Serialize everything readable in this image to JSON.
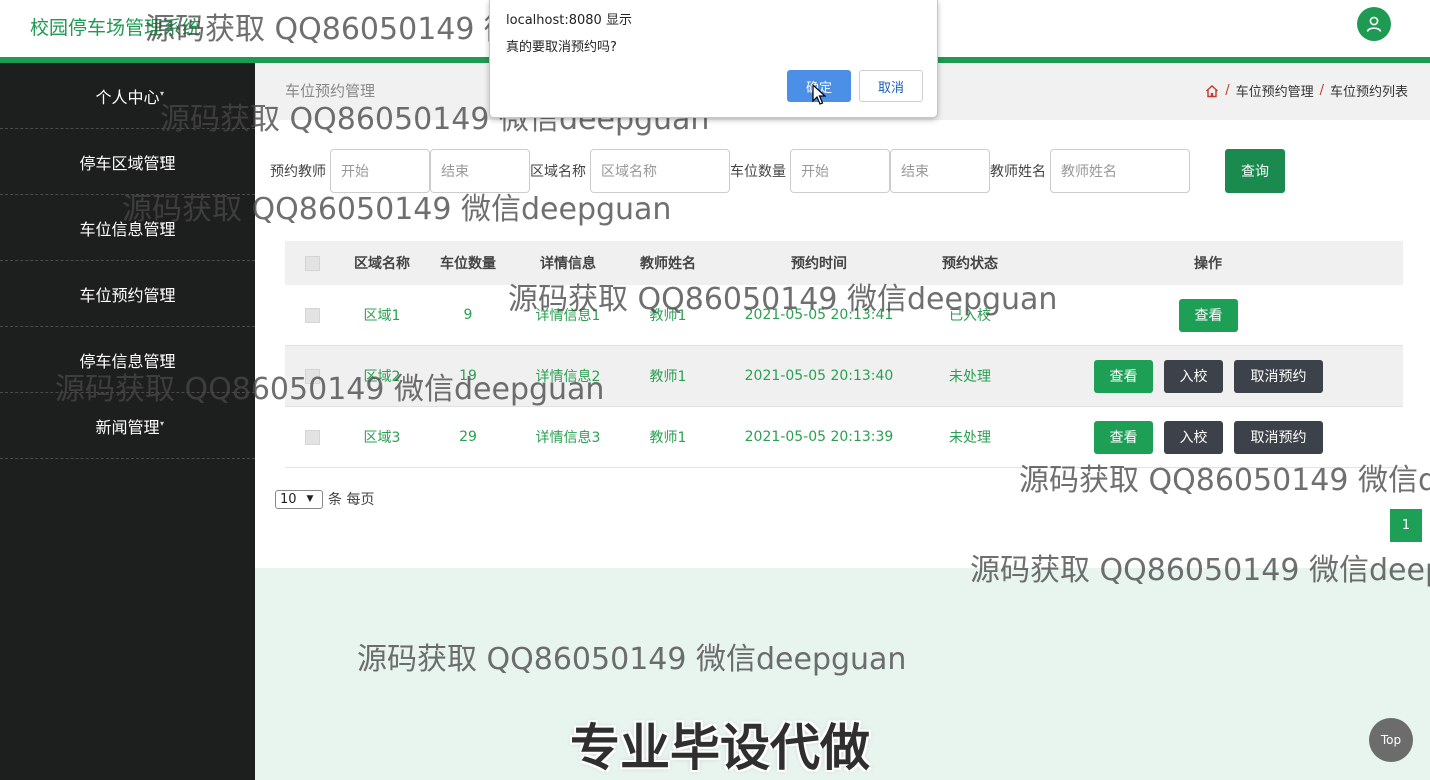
{
  "header": {
    "title": "校园停车场管理系统"
  },
  "sidebar": {
    "items": [
      {
        "label": "个人中心"
      },
      {
        "label": "停车区域管理"
      },
      {
        "label": "车位信息管理"
      },
      {
        "label": "车位预约管理"
      },
      {
        "label": "停车信息管理"
      },
      {
        "label": "新闻管理"
      }
    ]
  },
  "main": {
    "page_title": "车位预约管理",
    "breadcrumb": {
      "sep": "/",
      "items": [
        "车位预约管理",
        "车位预约列表"
      ]
    }
  },
  "search": {
    "teacher_label": "预约教师",
    "start_placeholder": "开始",
    "end_placeholder": "结束",
    "area_label": "区域名称",
    "area_placeholder": "区域名称",
    "count_label": "车位数量",
    "count_start_placeholder": "开始",
    "count_end_placeholder": "结束",
    "name_label": "教师姓名",
    "name_placeholder": "教师姓名",
    "query_label": "查询"
  },
  "table": {
    "headers": [
      "区域名称",
      "车位数量",
      "详情信息",
      "教师姓名",
      "预约时间",
      "预约状态",
      "操作"
    ],
    "rows": [
      {
        "area": "区域1",
        "count": "9",
        "detail": "详情信息1",
        "teacher": "教师1",
        "time": "2021-05-05 20:13:41",
        "status": "已入校"
      },
      {
        "area": "区域2",
        "count": "19",
        "detail": "详情信息2",
        "teacher": "教师1",
        "time": "2021-05-05 20:13:40",
        "status": "未处理"
      },
      {
        "area": "区域3",
        "count": "29",
        "detail": "详情信息3",
        "teacher": "教师1",
        "time": "2021-05-05 20:13:39",
        "status": "未处理"
      }
    ],
    "actions": {
      "view": "查看",
      "enter": "入校",
      "cancel": "取消预约"
    }
  },
  "pagination": {
    "page_size": "10",
    "per_page_label": "条 每页",
    "current_page": "1"
  },
  "top_button": "Top",
  "dialog": {
    "title": "localhost:8080 显示",
    "message": "真的要取消预约吗?",
    "ok": "确定",
    "cancel": "取消"
  },
  "watermark": {
    "text": "源码获取 QQ86050149 微信deepguan",
    "banner": "专业毕设代做"
  },
  "colors": {
    "brand_green": "#1f9a52",
    "sidebar_bg": "#1c1f1d",
    "dialog_ok": "#4c8fe6",
    "dark_button": "#3d4149"
  }
}
